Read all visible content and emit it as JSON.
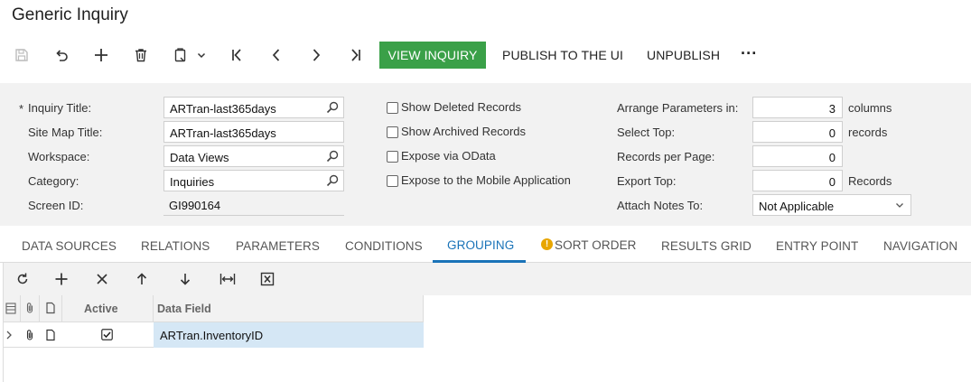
{
  "window": {
    "title": "Generic Inquiry"
  },
  "toolbar": {
    "save_icon": "save-icon",
    "undo_icon": "undo-icon",
    "add_icon": "plus-icon",
    "delete_icon": "trash-icon",
    "clipboard_icon": "clipboard-icon",
    "first_icon": "first-record-icon",
    "prev_icon": "previous-record-icon",
    "next_icon": "next-record-icon",
    "last_icon": "last-record-icon",
    "view_inquiry_label": "VIEW INQUIRY",
    "publish_label": "PUBLISH TO THE UI",
    "unpublish_label": "UNPUBLISH",
    "more_label": "···",
    "accent_color": "#3aa048"
  },
  "form": {
    "required_mark": "*",
    "inquiry_title_label": "Inquiry Title:",
    "inquiry_title_value": "ARTran-last365days",
    "site_map_title_label": "Site Map Title:",
    "site_map_title_value": "ARTran-last365days",
    "workspace_label": "Workspace:",
    "workspace_value": "Data Views",
    "category_label": "Category:",
    "category_value": "Inquiries",
    "screen_id_label": "Screen ID:",
    "screen_id_value": "GI990164",
    "show_deleted_label": "Show Deleted Records",
    "show_deleted_checked": false,
    "show_archived_label": "Show Archived Records",
    "show_archived_checked": false,
    "expose_odata_label": "Expose via OData",
    "expose_odata_checked": false,
    "expose_mobile_label": "Expose to the Mobile Application",
    "expose_mobile_checked": false,
    "arrange_label": "Arrange Parameters in:",
    "arrange_value": "3",
    "arrange_suffix": "columns",
    "select_top_label": "Select Top:",
    "select_top_value": "0",
    "select_top_suffix": "records",
    "records_per_page_label": "Records per Page:",
    "records_per_page_value": "0",
    "export_top_label": "Export Top:",
    "export_top_value": "0",
    "export_top_suffix": "Records",
    "attach_notes_label": "Attach Notes To:",
    "attach_notes_value": "Not Applicable"
  },
  "tabs": [
    {
      "label": "DATA SOURCES"
    },
    {
      "label": "RELATIONS"
    },
    {
      "label": "PARAMETERS"
    },
    {
      "label": "CONDITIONS"
    },
    {
      "label": "GROUPING",
      "active": true
    },
    {
      "label": "SORT ORDER",
      "warning": true
    },
    {
      "label": "RESULTS GRID"
    },
    {
      "label": "ENTRY POINT"
    },
    {
      "label": "NAVIGATION"
    }
  ],
  "grid": {
    "toolbar_icons": [
      "refresh-icon",
      "plus-icon",
      "close-icon",
      "arrow-up-icon",
      "arrow-down-icon",
      "fit-width-icon",
      "excel-export-icon"
    ],
    "columns": {
      "active": "Active",
      "data_field": "Data Field"
    },
    "rows": [
      {
        "active": true,
        "data_field": "ARTran.InventoryID"
      }
    ],
    "selected_row_color": "#d5e7f5"
  }
}
